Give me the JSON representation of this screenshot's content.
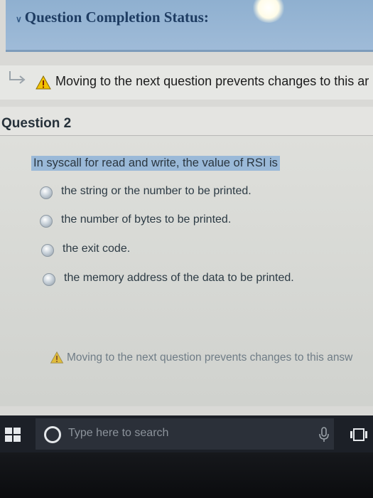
{
  "status_panel": {
    "title": "Question Completion Status:"
  },
  "notice": {
    "text": "Moving to the next question prevents changes to this ar"
  },
  "question": {
    "title": "Question 2",
    "text": "In syscall for read and write, the value of RSI is",
    "options": [
      "the string or the number to be printed.",
      "the number of bytes to be printed.",
      "the exit code.",
      "the memory address of the data to be printed."
    ]
  },
  "bottom_notice": {
    "text": "Moving to the next question prevents changes to this answ"
  },
  "taskbar": {
    "search_placeholder": "Type here to search"
  },
  "colors": {
    "panel_blue": "#8fb0d0",
    "highlight_blue": "#9ab9d8",
    "warning_yellow": "#f2c200",
    "taskbar_dark": "#1c2027"
  }
}
